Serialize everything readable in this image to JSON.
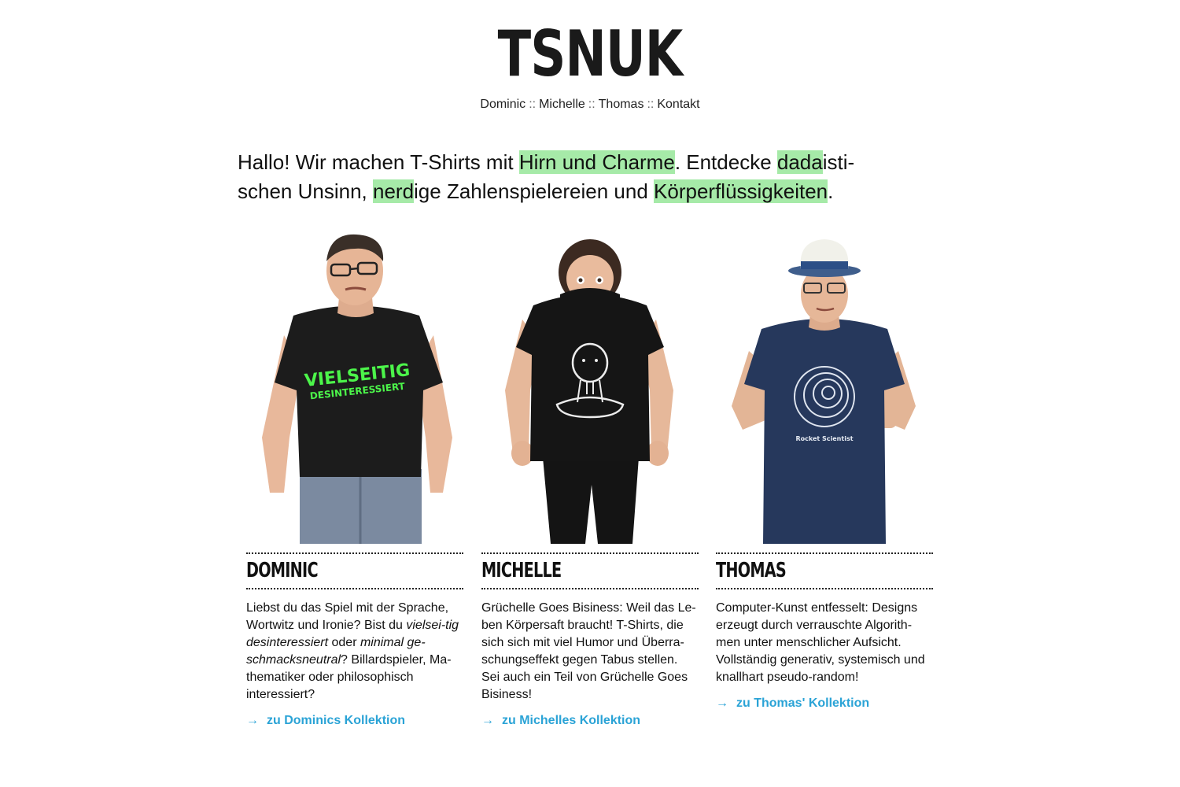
{
  "header": {
    "logo": "TSNUK",
    "nav": [
      {
        "label": "Dominic"
      },
      {
        "label": "Michelle"
      },
      {
        "label": "Thomas"
      },
      {
        "label": "Kontakt"
      }
    ],
    "separator": "::"
  },
  "intro": {
    "p1": "Hallo! Wir machen T-Shirts mit ",
    "h1": "Hirn und Charme",
    "p2": ". Entdecke ",
    "h2": "dada",
    "p3": "isti-",
    "p4": "schen Unsinn, ",
    "h3": "nerd",
    "p5": "ige Zahlenspielereien und ",
    "h4": "Körperflüssigkeiten",
    "p6": "."
  },
  "people": [
    {
      "name": "Dominic",
      "shirt_line1": "VIELSEITIG",
      "shirt_line2": "DESINTERESSIERT",
      "desc_1": "Liebst du das Spiel mit der Sprache, Wortwitz und Ironie? Bist du ",
      "desc_em1": "vielsei-tig desinteressiert",
      "desc_2": " oder ",
      "desc_em2": "minimal ge-schmacksneutral",
      "desc_3": "? Billardspieler, Ma-thematiker oder philosophisch interessiert?",
      "link_arrow": "→",
      "link_label": "zu Dominics Kollektion"
    },
    {
      "name": "Michelle",
      "desc": "Grüchelle Goes Bisiness: Weil das Le-ben Körpersaft braucht! T-Shirts, die sich sich mit viel Humor und Überra-schungseffekt gegen Tabus stellen. Sei auch ein Teil von Grüchelle Goes Bisiness!",
      "link_arrow": "→",
      "link_label": "zu Michelles Kollektion"
    },
    {
      "name": "Thomas",
      "shirt_text": "Rocket Scientist",
      "desc": "Computer-Kunst entfesselt: Designs erzeugt durch verrauschte Algorith-men unter menschlicher Aufsicht. Vollständig generativ, systemisch und knallhart pseudo-random!",
      "link_arrow": "→",
      "link_label": "zu Thomas' Kollektion"
    }
  ],
  "colors": {
    "highlight": "#a6eaa8",
    "link": "#2aa3d6",
    "dominic_shirt": "#1c1c1c",
    "dominic_print": "#4cf54a",
    "michelle_shirt": "#151515",
    "thomas_shirt": "#26385c"
  }
}
